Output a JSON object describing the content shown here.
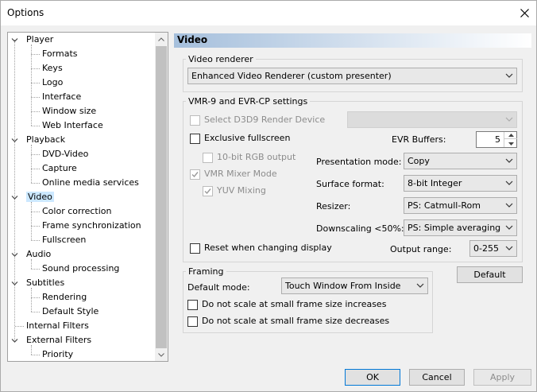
{
  "window": {
    "title": "Options"
  },
  "tree": {
    "items": [
      {
        "label": "Player",
        "level": 0,
        "expanded": true
      },
      {
        "label": "Formats",
        "level": 1
      },
      {
        "label": "Keys",
        "level": 1
      },
      {
        "label": "Logo",
        "level": 1
      },
      {
        "label": "Interface",
        "level": 1
      },
      {
        "label": "Window size",
        "level": 1
      },
      {
        "label": "Web Interface",
        "level": 1
      },
      {
        "label": "Playback",
        "level": 0,
        "expanded": true
      },
      {
        "label": "DVD-Video",
        "level": 1
      },
      {
        "label": "Capture",
        "level": 1
      },
      {
        "label": "Online media services",
        "level": 1
      },
      {
        "label": "Video",
        "level": 0,
        "expanded": true,
        "selected": true
      },
      {
        "label": "Color correction",
        "level": 1
      },
      {
        "label": "Frame synchronization",
        "level": 1
      },
      {
        "label": "Fullscreen",
        "level": 1
      },
      {
        "label": "Audio",
        "level": 0,
        "expanded": true
      },
      {
        "label": "Sound processing",
        "level": 1
      },
      {
        "label": "Subtitles",
        "level": 0,
        "expanded": true
      },
      {
        "label": "Rendering",
        "level": 1
      },
      {
        "label": "Default Style",
        "level": 1
      },
      {
        "label": "Internal Filters",
        "level": 0
      },
      {
        "label": "External Filters",
        "level": 0,
        "expanded": true
      },
      {
        "label": "Priority",
        "level": 1
      }
    ]
  },
  "panel": {
    "title": "Video"
  },
  "renderer": {
    "group_label": "Video renderer",
    "value": "Enhanced Video Renderer (custom presenter)"
  },
  "vmr": {
    "group_label": "VMR-9 and EVR-CP settings",
    "select_d3d9": "Select D3D9 Render Device",
    "d3d9_device": "",
    "exclusive_fullscreen": "Exclusive fullscreen",
    "rgb10": "10-bit RGB output",
    "vmr_mixer": "VMR Mixer Mode",
    "yuv_mixing": "YUV Mixing",
    "evr_buffers_label": "EVR Buffers:",
    "evr_buffers_value": "5",
    "presentation_mode_label": "Presentation mode:",
    "presentation_mode_value": "Copy",
    "surface_format_label": "Surface format:",
    "surface_format_value": "8-bit Integer",
    "resizer_label": "Resizer:",
    "resizer_value": "PS: Catmull-Rom",
    "downscaling_label": "Downscaling <50%:",
    "downscaling_value": "PS: Simple averaging",
    "reset_display": "Reset when changing display",
    "output_range_label": "Output range:",
    "output_range_value": "0-255"
  },
  "framing": {
    "group_label": "Framing",
    "default_mode_label": "Default mode:",
    "default_mode_value": "Touch Window From Inside",
    "no_scale_increase": "Do not scale at small frame size increases",
    "no_scale_decrease": "Do not scale at small frame size decreases"
  },
  "buttons": {
    "default": "Default",
    "ok": "OK",
    "cancel": "Cancel",
    "apply": "Apply"
  },
  "colors": {
    "selection": "#cce8ff",
    "accent": "#0078d7",
    "header_gradient_start": "#a5bfdc"
  }
}
